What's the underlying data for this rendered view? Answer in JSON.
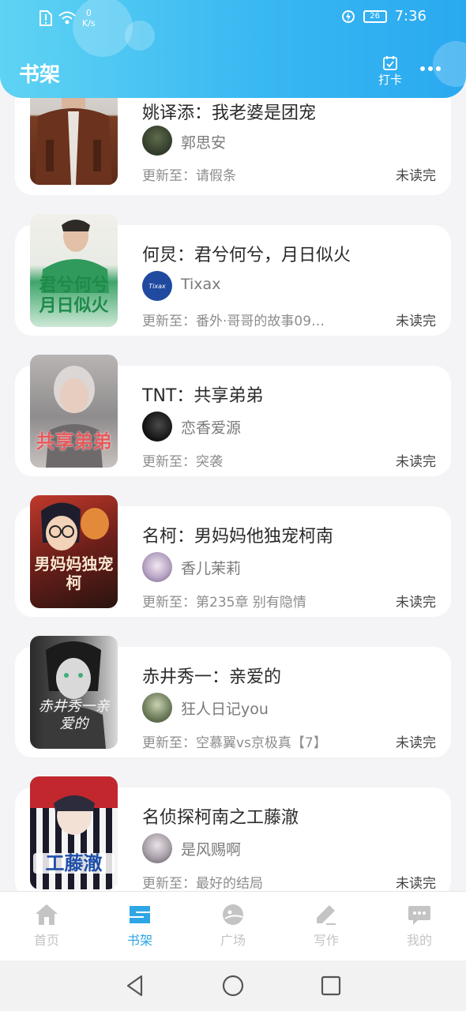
{
  "status_bar": {
    "net_speed_value": "0",
    "net_speed_unit": "K/s",
    "battery": "26",
    "time": "7:36"
  },
  "header": {
    "title": "书架",
    "checkin_label": "打卡"
  },
  "colors": {
    "accent": "#2ea6e6",
    "header_start": "#5fd3f3",
    "header_end": "#2aa9f0"
  },
  "books": [
    {
      "title": "姚译添：我老婆是团宠",
      "author": "郭思安",
      "update_label": "更新至：",
      "chapter": "请假条",
      "status": "未读完",
      "cover_text": "",
      "cover_icon": "cover-person-brown-jacket"
    },
    {
      "title": "何炅：君兮何兮，月日似火",
      "author": "Tixax",
      "update_label": "更新至：",
      "chapter": "番外·哥哥的故事09…",
      "status": "未读完",
      "cover_text": "君兮何兮月日似火",
      "cover_icon": "cover-person-green"
    },
    {
      "title": "TNT：共享弟弟",
      "author": "恋香爱源",
      "update_label": "更新至：",
      "chapter": "突袭",
      "status": "未读完",
      "cover_text": "共享弟弟",
      "cover_icon": "cover-person-silver-hair"
    },
    {
      "title": "名柯：男妈妈他独宠柯南",
      "author": "香儿茉莉",
      "update_label": "更新至：",
      "chapter": "第235章 别有隐情",
      "status": "未读完",
      "cover_text": "男妈妈独宠柯",
      "cover_icon": "cover-anime-conan"
    },
    {
      "title": "赤井秀一：亲爱的",
      "author": "狂人日记you",
      "update_label": "更新至：",
      "chapter": "空慕翼vs京极真【7】",
      "status": "未读完",
      "cover_text": "赤井秀一亲爱的",
      "cover_icon": "cover-anime-monochrome"
    },
    {
      "title": "名侦探柯南之工藤澈",
      "author": "是风赐啊",
      "update_label": "更新至：",
      "chapter": "最好的结局",
      "status": "未读完",
      "cover_text": "工藤澈",
      "cover_icon": "cover-anime-striped"
    }
  ],
  "bottom_nav": [
    {
      "label": "首页",
      "icon": "home-icon",
      "active": false
    },
    {
      "label": "书架",
      "icon": "bookshelf-icon",
      "active": true
    },
    {
      "label": "广场",
      "icon": "plaza-icon",
      "active": false
    },
    {
      "label": "写作",
      "icon": "pen-icon",
      "active": false
    },
    {
      "label": "我的",
      "icon": "chat-icon",
      "active": false
    }
  ]
}
